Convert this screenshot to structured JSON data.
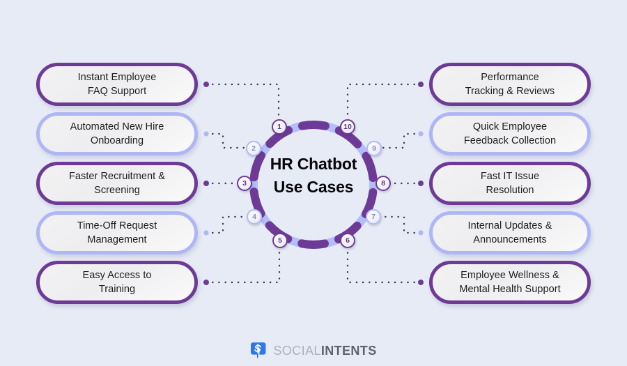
{
  "theme": {
    "background": "#e7ebf5",
    "accent_dark": "#6d3b96",
    "accent_light": "#aeb6f5",
    "box_fill": "#f1f1f3",
    "text": "#1d1d1f",
    "logo_blue": "#2f77ec"
  },
  "center": {
    "title": "HR Chatbot\nUse Cases"
  },
  "ring": {
    "badges": [
      {
        "number": "1",
        "tone": "dark"
      },
      {
        "number": "2",
        "tone": "light"
      },
      {
        "number": "3",
        "tone": "dark"
      },
      {
        "number": "4",
        "tone": "light"
      },
      {
        "number": "5",
        "tone": "dark"
      },
      {
        "number": "6",
        "tone": "dark"
      },
      {
        "number": "7",
        "tone": "light"
      },
      {
        "number": "8",
        "tone": "dark"
      },
      {
        "number": "9",
        "tone": "light"
      },
      {
        "number": "10",
        "tone": "dark"
      }
    ]
  },
  "left_items": [
    {
      "label": "Instant Employee\nFAQ Support",
      "tone": "dark",
      "badge": "1"
    },
    {
      "label": "Automated New Hire\nOnboarding",
      "tone": "light",
      "badge": "2"
    },
    {
      "label": "Faster Recruitment &\nScreening",
      "tone": "dark",
      "badge": "3"
    },
    {
      "label": "Time-Off Request\nManagement",
      "tone": "light",
      "badge": "4"
    },
    {
      "label": "Easy Access to\nTraining",
      "tone": "dark",
      "badge": "5"
    }
  ],
  "right_items": [
    {
      "label": "Performance\nTracking & Reviews",
      "tone": "dark",
      "badge": "10"
    },
    {
      "label": "Quick Employee\nFeedback Collection",
      "tone": "light",
      "badge": "9"
    },
    {
      "label": "Fast IT Issue\nResolution",
      "tone": "dark",
      "badge": "8"
    },
    {
      "label": "Internal Updates &\nAnnouncements",
      "tone": "light",
      "badge": "7"
    },
    {
      "label": "Employee Wellness &\nMental Health Support",
      "tone": "dark",
      "badge": "6"
    }
  ],
  "footer": {
    "logo_primary": "SOCIAL",
    "logo_secondary": "INTENTS",
    "logo_icon": "speech-bubble-icon"
  }
}
